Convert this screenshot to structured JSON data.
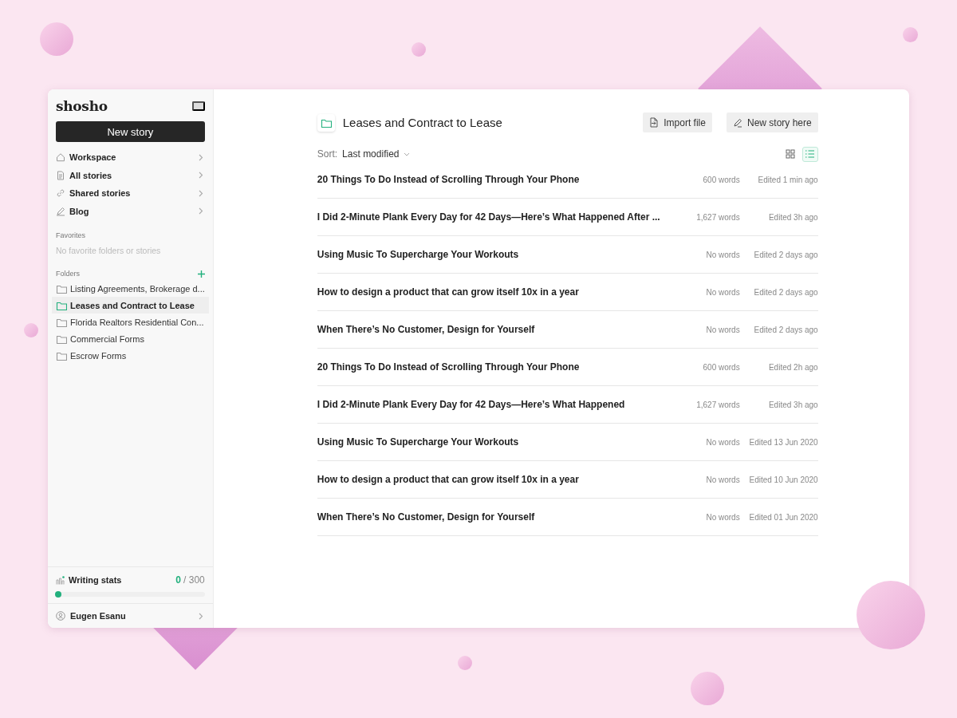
{
  "sidebar": {
    "logo": "shosho",
    "new_story_button": "New story",
    "nav": [
      {
        "kind": "home",
        "label": "Workspace"
      },
      {
        "kind": "doc",
        "label": "All stories"
      },
      {
        "kind": "link",
        "label": "Shared stories"
      },
      {
        "kind": "pen",
        "label": "Blog"
      }
    ],
    "favorites": {
      "heading": "Favorites",
      "empty_text": "No favorite folders or stories"
    },
    "folders": {
      "heading": "Folders",
      "items": [
        {
          "label": "Listing Agreements, Brokerage d...",
          "selected": false
        },
        {
          "label": "Leases and Contract to Lease",
          "selected": true
        },
        {
          "label": "Florida Realtors Residential Con...",
          "selected": false
        },
        {
          "label": "Commercial Forms",
          "selected": false
        },
        {
          "label": "Escrow Forms",
          "selected": false
        }
      ]
    },
    "writing_stats": {
      "label": "Writing stats",
      "count": "0",
      "goal": "/ 300",
      "level": 0
    },
    "user": {
      "name": "Eugen Esanu"
    }
  },
  "main": {
    "title": "Leases and Contract to Lease",
    "buttons": [
      {
        "kind": "import",
        "label": "Import file"
      },
      {
        "kind": "new",
        "label": "New story here"
      }
    ],
    "sort": {
      "label": "Sort:",
      "value": "Last modified"
    },
    "view_toggle": [
      {
        "kind": "grid",
        "selected": false
      },
      {
        "kind": "list",
        "selected": true
      }
    ],
    "stories": [
      {
        "title": "20 Things To Do Instead of Scrolling Through Your Phone",
        "words": "600 words",
        "edited": "Edited 1 min ago"
      },
      {
        "title": "I Did 2-Minute Plank Every Day for 42 Days—Here’s What Happened After ...",
        "words": "1,627 words",
        "edited": "Edited 3h ago"
      },
      {
        "title": "Using Music To Supercharge Your Workouts",
        "words": "No words",
        "edited": "Edited 2 days ago"
      },
      {
        "title": "How to design a product that can grow itself 10x in a year",
        "words": "No words",
        "edited": "Edited 2 days ago"
      },
      {
        "title": "When There’s No Customer, Design for Yourself",
        "words": "No words",
        "edited": "Edited 2 days ago"
      },
      {
        "title": "20 Things To Do Instead of Scrolling Through Your Phone",
        "words": "600 words",
        "edited": "Edited 2h ago"
      },
      {
        "title": "I Did 2-Minute Plank Every Day for 42 Days—Here’s What Happened",
        "words": "1,627 words",
        "edited": "Edited 3h ago"
      },
      {
        "title": "Using Music To Supercharge Your Workouts",
        "words": "No words",
        "edited": "Edited 13 Jun 2020"
      },
      {
        "title": "How to design a product that can grow itself 10x in a year",
        "words": "No words",
        "edited": "Edited 10 Jun 2020"
      },
      {
        "title": "When There’s No Customer, Design for Yourself",
        "words": "No words",
        "edited": "Edited 01 Jun 2020"
      }
    ]
  }
}
